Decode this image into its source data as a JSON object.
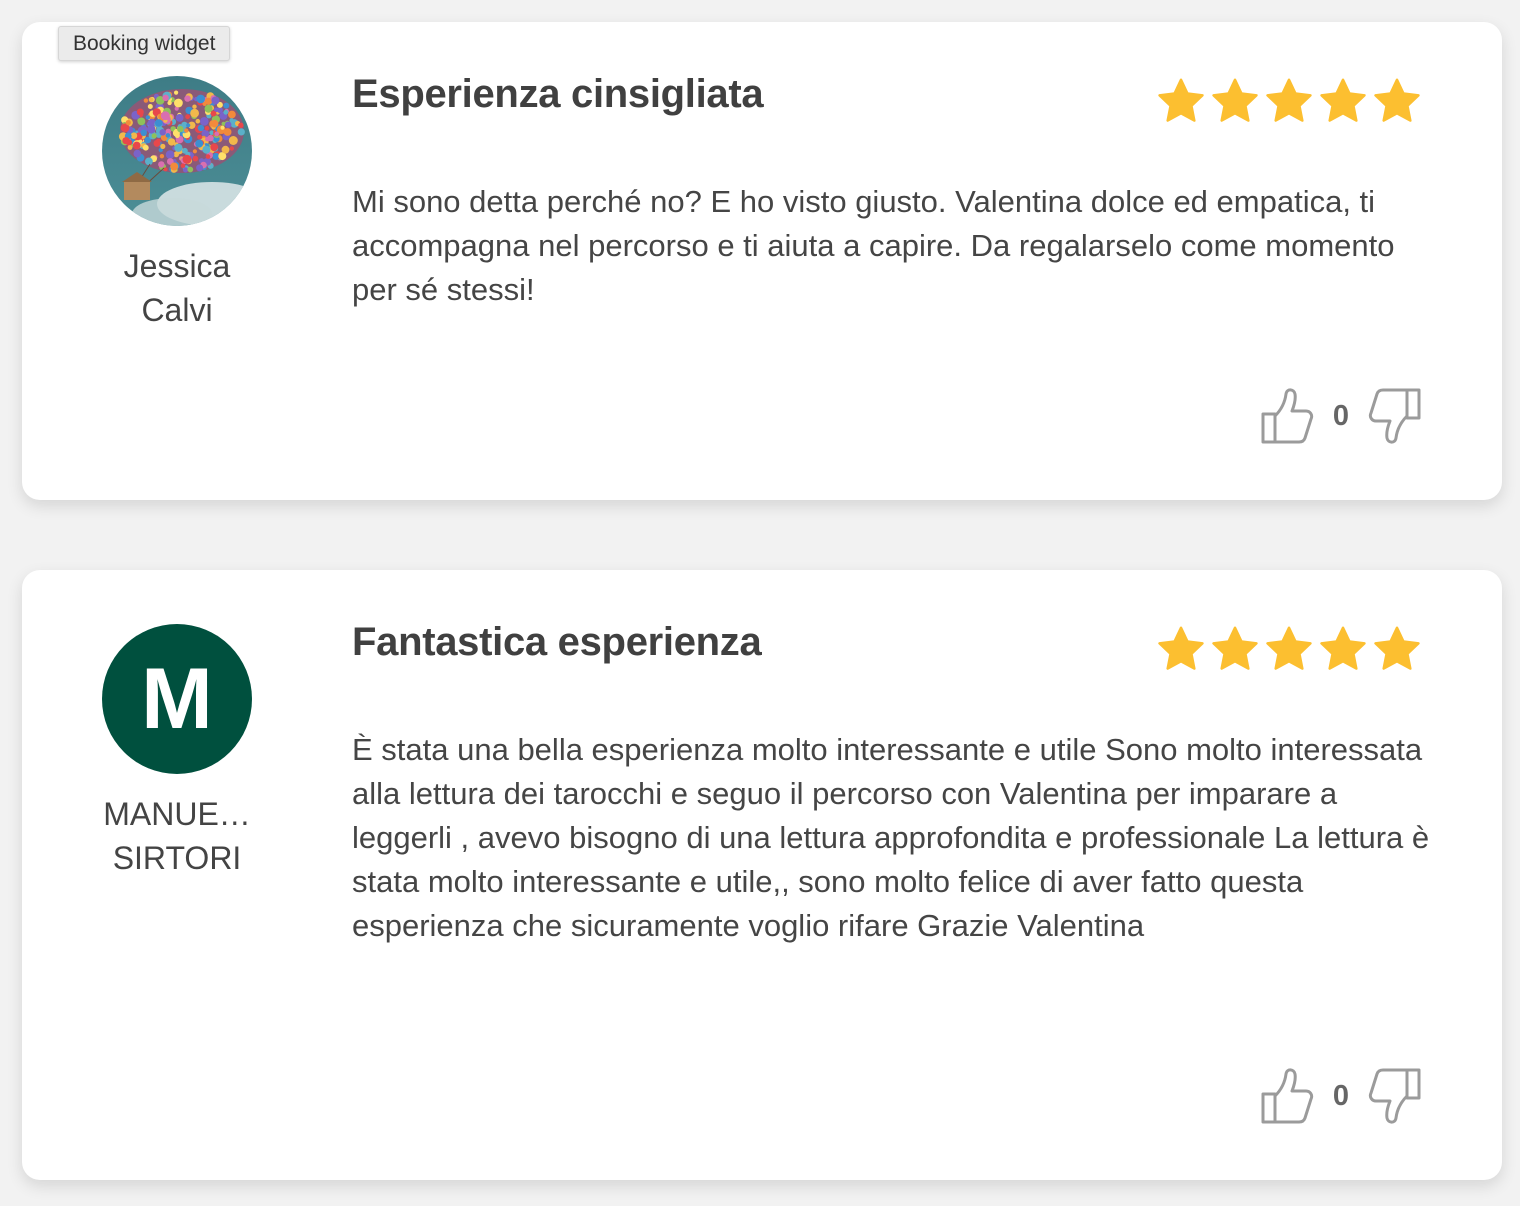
{
  "tooltip": "Booking widget",
  "reviews": [
    {
      "author_first": "Jessica",
      "author_last": "Calvi",
      "avatar_type": "photo-hot-air-balloons",
      "title": "Esperienza cinsigliata",
      "rating": 5,
      "text": "Mi sono detta perché no? E ho visto giusto. Valentina dolce ed empatica, ti accompagna nel percorso e ti aiuta a capire. Da regalarselo come momento per sé stessi!",
      "likes": "0"
    },
    {
      "author_first": "MANUE…",
      "author_last": "SIRTORI",
      "avatar_letter": "M",
      "avatar_color": "#00503e",
      "title": "Fantastica esperienza",
      "rating": 5,
      "text": "È stata una bella esperienza molto interessante e utile Sono molto interessata alla lettura dei tarocchi e seguo il percorso con Valentina per imparare a leggerli , avevo bisogno di una lettura approfondita e professionale La lettura è stata molto interessante e utile,, sono molto felice di aver fatto questa esperienza che sicuramente voglio rifare Grazie Valentina",
      "likes": "0"
    }
  ],
  "colors": {
    "star": "#fcbf30",
    "card_bg": "#ffffff",
    "page_bg": "#f2f2f2"
  },
  "icons": [
    "thumbs-up-icon",
    "thumbs-down-icon",
    "star-icon"
  ]
}
